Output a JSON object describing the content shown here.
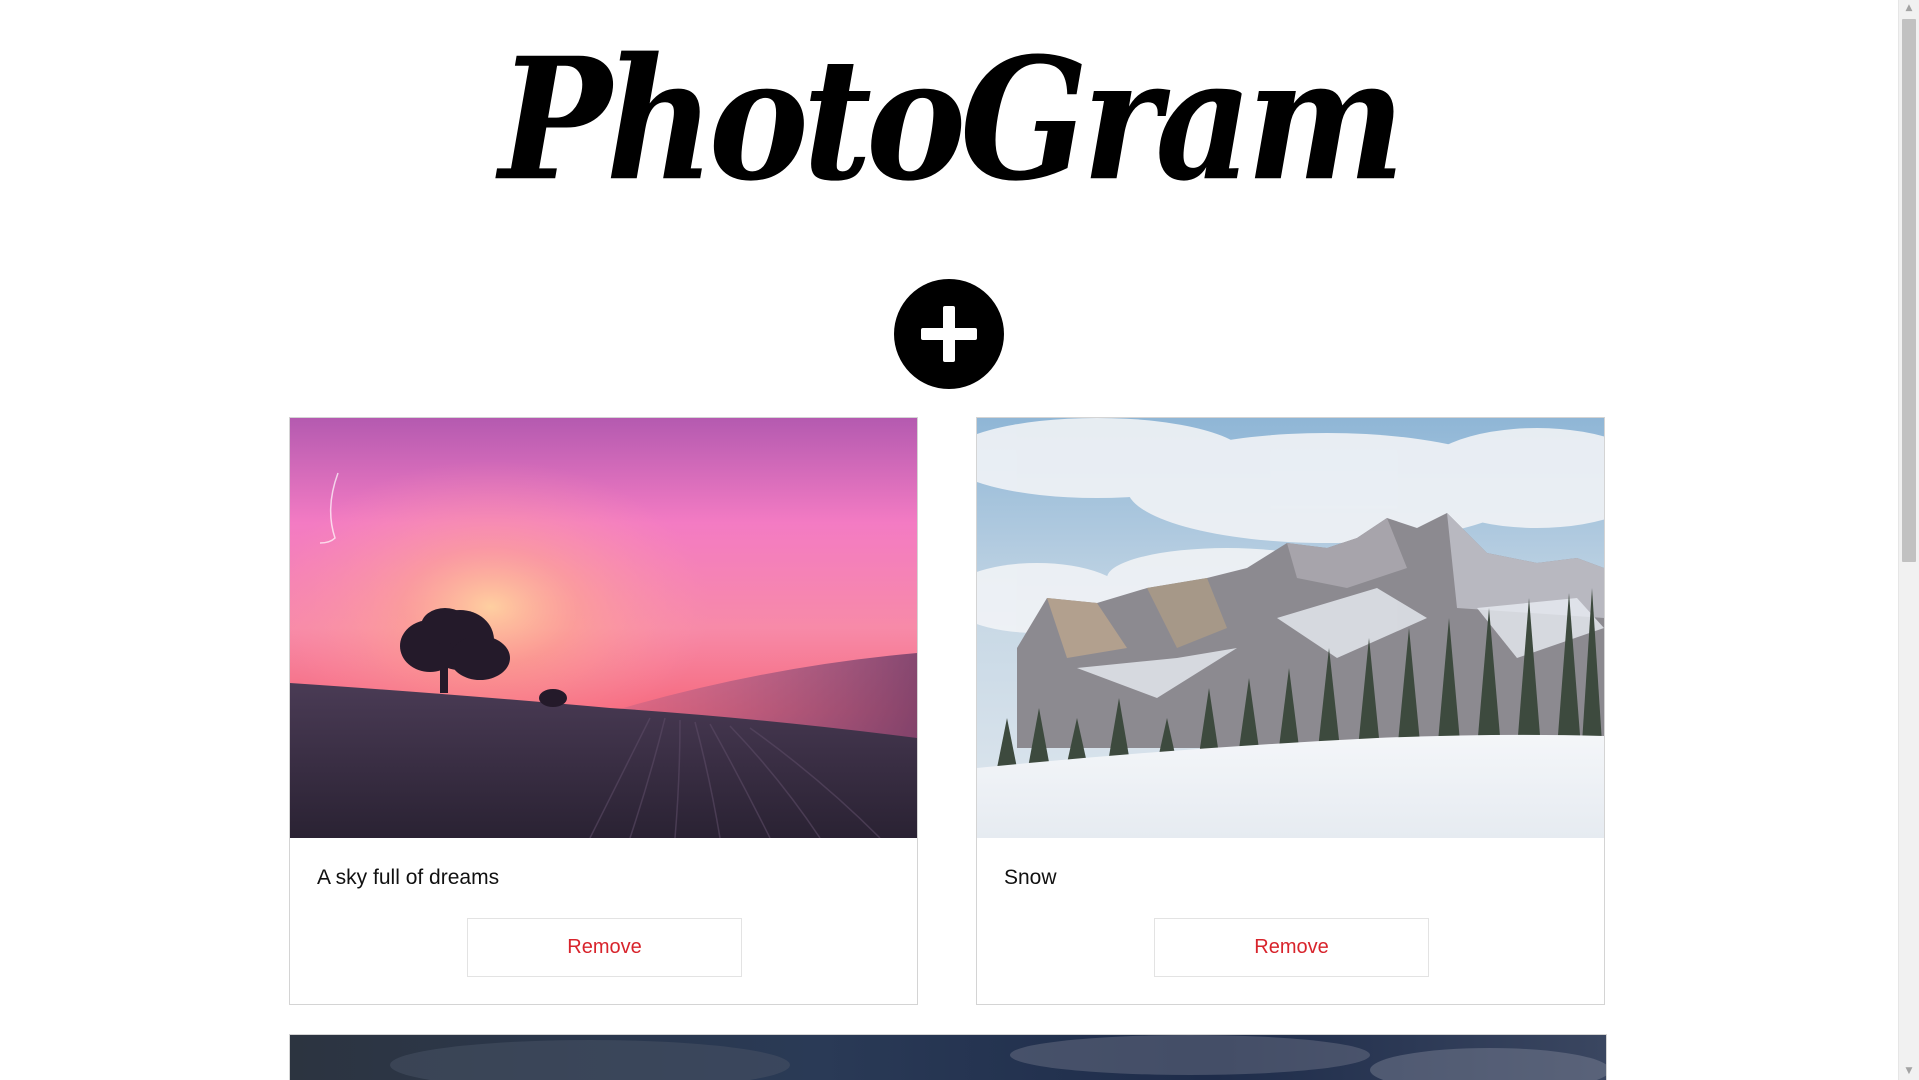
{
  "app": {
    "logo_text": "PhotoGram"
  },
  "toolbar": {
    "add_icon": "plus-icon"
  },
  "photos": [
    {
      "caption": "A sky full of dreams",
      "remove_label": "Remove",
      "image_subject": "pink sunset over field with tree"
    },
    {
      "caption": "Snow",
      "remove_label": "Remove",
      "image_subject": "snowy mountains with pine forest"
    },
    {
      "caption": "",
      "image_subject": "dark cloudy sky"
    }
  ],
  "colors": {
    "accent_remove": "#d8242c",
    "logo": "#000000",
    "add_button": "#000000"
  }
}
